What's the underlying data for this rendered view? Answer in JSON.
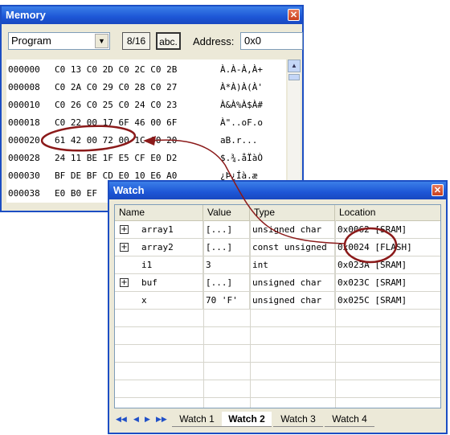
{
  "memory_window": {
    "title": "Memory",
    "close_icon": "close-icon",
    "memory_type": "Program",
    "btn_816": "8/16",
    "btn_abc": "abc.",
    "address_label": "Address:",
    "address_value": "0x0",
    "rows": [
      {
        "addr": "000000",
        "bytes": "C0 13 C0 2D C0 2C C0 2B",
        "ascii": "À.À-À,À+"
      },
      {
        "addr": "000008",
        "bytes": "C0 2A C0 29 C0 28 C0 27",
        "ascii": "À*À)À(À'"
      },
      {
        "addr": "000010",
        "bytes": "C0 26 C0 25 C0 24 C0 23",
        "ascii": "À&À%À$À#"
      },
      {
        "addr": "000018",
        "bytes": "C0 22 00 17 6F 46 00 6F",
        "ascii": "À\"..oF.o"
      },
      {
        "addr": "000020",
        "bytes": "61 42 00 72 00 1C 00 20",
        "ascii": "aB.r... "
      },
      {
        "addr": "000028",
        "bytes": "24 11 BE 1F E5 CF E0 D2",
        "ascii": "$.¾.åÏàÒ"
      },
      {
        "addr": "000030",
        "bytes": "BF DE BF CD E0 10 E6 A0",
        "ascii": "¿Þ¿Íà.æ "
      },
      {
        "addr": "000038",
        "bytes": "E0 B0 EF",
        "ascii": ""
      }
    ]
  },
  "watch_window": {
    "title": "Watch",
    "columns": [
      "Name",
      "Value",
      "Type",
      "Location"
    ],
    "rows": [
      {
        "name": "array1",
        "value": "[...]",
        "type": "unsigned char",
        "location": "0x0062 [SRAM]",
        "expandable": true
      },
      {
        "name": "array2",
        "value": "[...]",
        "type": "const unsigned",
        "location": "0x0024 [FLASH]",
        "expandable": true
      },
      {
        "name": "i1",
        "value": "3",
        "type": "int",
        "location": "0x023A [SRAM]",
        "expandable": false
      },
      {
        "name": "buf",
        "value": "[...]",
        "type": "unsigned char",
        "location": "0x023C [SRAM]",
        "expandable": true
      },
      {
        "name": "x",
        "value": "70 'F'",
        "type": "unsigned char",
        "location": "0x025C [SRAM]",
        "expandable": false
      }
    ],
    "tabs": [
      "Watch 1",
      "Watch 2",
      "Watch 3",
      "Watch 4"
    ],
    "active_tab": "Watch 2",
    "nav_icons": [
      "first-icon",
      "prev-icon",
      "next-icon",
      "last-icon"
    ]
  },
  "annotation_color": "#8b1a1a"
}
